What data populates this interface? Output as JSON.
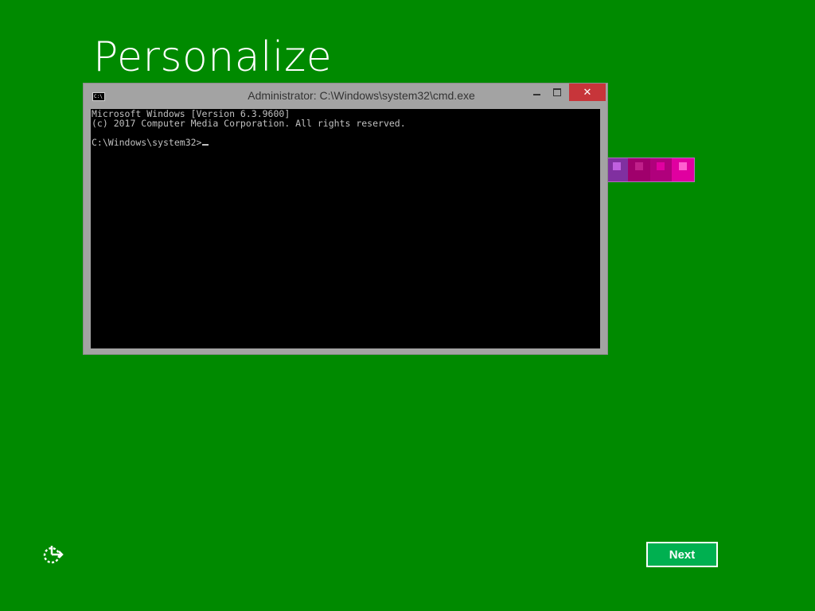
{
  "page": {
    "title": "Personalize",
    "background": "#008a00"
  },
  "color_swatches": [
    {
      "name": "purple",
      "base": "#8030a0",
      "dot": "#c060e0"
    },
    {
      "name": "plum",
      "base": "#a0006c",
      "dot": "#c0208a"
    },
    {
      "name": "magenta",
      "base": "#b0007c",
      "dot": "#e000a0"
    },
    {
      "name": "pink",
      "base": "#e000a0",
      "dot": "#ff60d0"
    }
  ],
  "cmd_window": {
    "title": "Administrator: C:\\Windows\\system32\\cmd.exe",
    "icon_text": "C:\\",
    "close_glyph": "✕",
    "lines": [
      "Microsoft Windows [Version 6.3.9600]",
      "(c) 2017 Computer Media Corporation. All rights reserved.",
      "",
      "C:\\Windows\\system32>"
    ]
  },
  "footer": {
    "next_label": "Next",
    "ease_of_access_icon": "ease-of-access-icon"
  }
}
